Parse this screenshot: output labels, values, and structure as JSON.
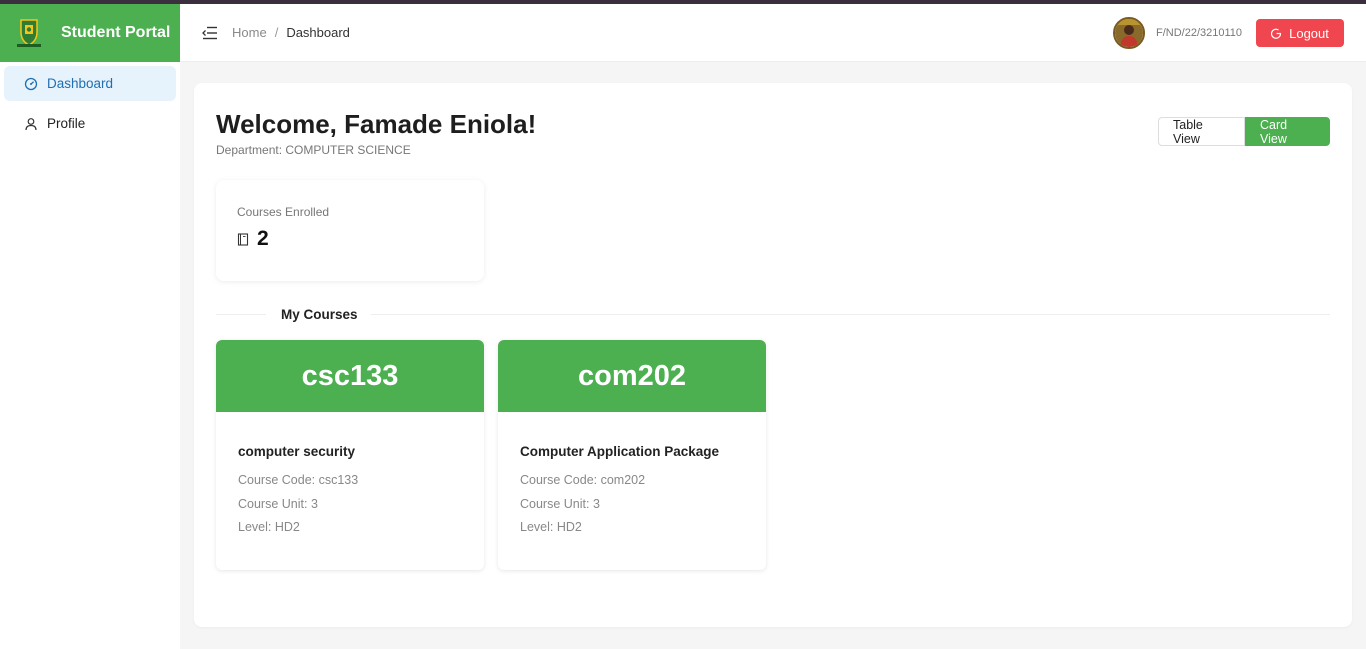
{
  "brand": {
    "title": "Student Portal"
  },
  "sidebar": {
    "items": [
      {
        "label": "Dashboard",
        "icon": "dashboard-icon",
        "active": true
      },
      {
        "label": "Profile",
        "icon": "user-icon",
        "active": false
      }
    ]
  },
  "header": {
    "breadcrumb": {
      "home": "Home",
      "separator": "/",
      "current": "Dashboard"
    },
    "matric_number": "F/ND/22/3210110",
    "logout_label": "Logout"
  },
  "main": {
    "welcome": "Welcome, Famade Eniola!",
    "department": "Department: COMPUTER SCIENCE",
    "view_toggle": {
      "table_label": "Table View",
      "card_label": "Card View",
      "selected": "Card View"
    },
    "stats": {
      "courses_enrolled_label": "Courses Enrolled",
      "courses_enrolled_value": "2"
    },
    "my_courses_title": "My Courses",
    "courses": [
      {
        "header": "csc133",
        "name": "computer security",
        "code": "Course Code: csc133",
        "unit": "Course Unit: 3",
        "level": "Level: HD2"
      },
      {
        "header": "com202",
        "name": "Computer Application Package",
        "code": "Course Code: com202",
        "unit": "Course Unit: 3",
        "level": "Level: HD2"
      }
    ]
  },
  "colors": {
    "brand_green": "#4caf50",
    "logout_red": "#f0464f",
    "active_nav_bg": "#e6f2fc",
    "active_nav_text": "#1f6fb2"
  }
}
